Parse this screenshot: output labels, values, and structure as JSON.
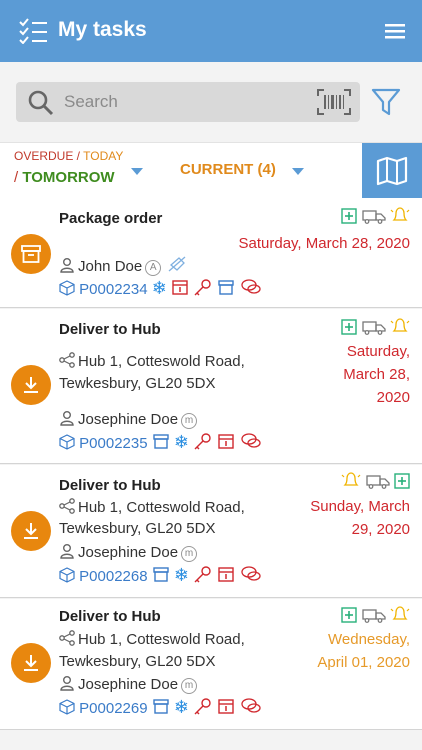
{
  "app": {
    "title": "My tasks",
    "tasks_icon": "task-list-icon",
    "menu_icon": "hamburger-menu-icon",
    "brand_color": "#5b9bd5",
    "accent_color": "#e8870e"
  },
  "search": {
    "placeholder": "Search",
    "value": "",
    "barcode_icon": "barcode-scan-icon",
    "filter_icon": "filter-icon"
  },
  "tabs": {
    "period": {
      "overdue": "OVERDUE",
      "sep1": " / ",
      "today": "TODAY",
      "sep2": "/ ",
      "tomorrow": "TOMORROW"
    },
    "current": "CURRENT (4)",
    "map_icon": "map-icon"
  },
  "tasks": [
    {
      "type_icon": "archive-box-icon",
      "title": "Package order",
      "address": [],
      "contact": "John Doe",
      "contact_badge": "A",
      "ref": "P0002234",
      "date_lines": [
        "Saturday, March 28, 2020"
      ],
      "date_color": "#d0282e"
    },
    {
      "type_icon": "download-icon",
      "title": "Deliver to Hub",
      "address": [
        "Hub 1, Cotteswold Road,",
        "Tewkesbury, GL20 5DX"
      ],
      "contact": "Josephine Doe",
      "contact_badge": "m",
      "ref": "P0002235",
      "date_lines": [
        "Saturday,",
        "March 28,",
        "2020"
      ],
      "date_color": "#d0282e"
    },
    {
      "type_icon": "download-icon",
      "title": "Deliver to Hub",
      "address": [
        "Hub 1, Cotteswold Road,",
        "Tewkesbury, GL20 5DX"
      ],
      "contact": "Josephine Doe",
      "contact_badge": "m",
      "ref": "P0002268",
      "date_lines": [
        "Sunday, March",
        "29, 2020"
      ],
      "date_color": "#d0282e"
    },
    {
      "type_icon": "download-icon",
      "title": "Deliver to Hub",
      "address": [
        "Hub 1, Cotteswold Road,",
        "Tewkesbury, GL20 5DX"
      ],
      "contact": "Josephine Doe",
      "contact_badge": "m",
      "ref": "P0002269",
      "date_lines": [
        "Wednesday,",
        "April 01, 2020"
      ],
      "date_color": "#e69a2a"
    }
  ]
}
